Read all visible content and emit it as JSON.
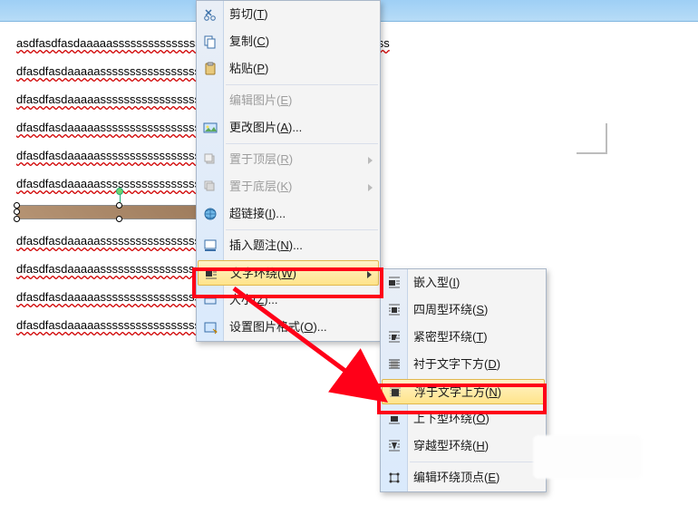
{
  "doc": {
    "lines": [
      "asdfasdfasdaaaaasssssssssssssssssssssssssssssssssssssssssssssss",
      "dfasdfasdaaaaasssssssssssssssssssssssssssssssssssssssssssssss",
      "dfasdfasdaaaaasssssssssssssssssssssssssssssssssssssssssssssss",
      "dfasdfasdaaaaasssssssssssssssssssssssssssssssssssssssssssssss",
      "dfasdfasdaaaaasssssssssssssssssssssssssssssssssssssssssssssss",
      "dfasdfasdaaaaasssssssssssssssssssssssssssssssssssssssssssssss",
      "dfasdfasdaaaaassssssssssssssssssssssssssssssssssss",
      "dfasdfasdaaaaassssssssssssssssssssssssssssssssssss",
      "dfasdfasdaaaaassssssssssssssssssssssssssssssssssss",
      "dfasdfasdaaaaassssssssssssssssssssssssssssssssssss"
    ]
  },
  "menu1": {
    "cut": "剪切(T)",
    "copy": "复制(C)",
    "paste": "粘贴(P)",
    "editpic": "编辑图片(E)",
    "changepic": "更改图片(A)...",
    "bringfront": "置于顶层(R)",
    "sendback": "置于底层(K)",
    "hyperlink": "超链接(I)...",
    "caption": "插入题注(N)...",
    "wrap": "文字环绕(W)",
    "size": "大小(Z)...",
    "format": "设置图片格式(O)..."
  },
  "menu2": {
    "inline": "嵌入型(I)",
    "square": "四周型环绕(S)",
    "tight": "紧密型环绕(T)",
    "behind": "衬于文字下方(D)",
    "front": "浮于文字上方(N)",
    "topbottom": "上下型环绕(O)",
    "through": "穿越型环绕(H)",
    "editwrap": "编辑环绕顶点(E)"
  }
}
